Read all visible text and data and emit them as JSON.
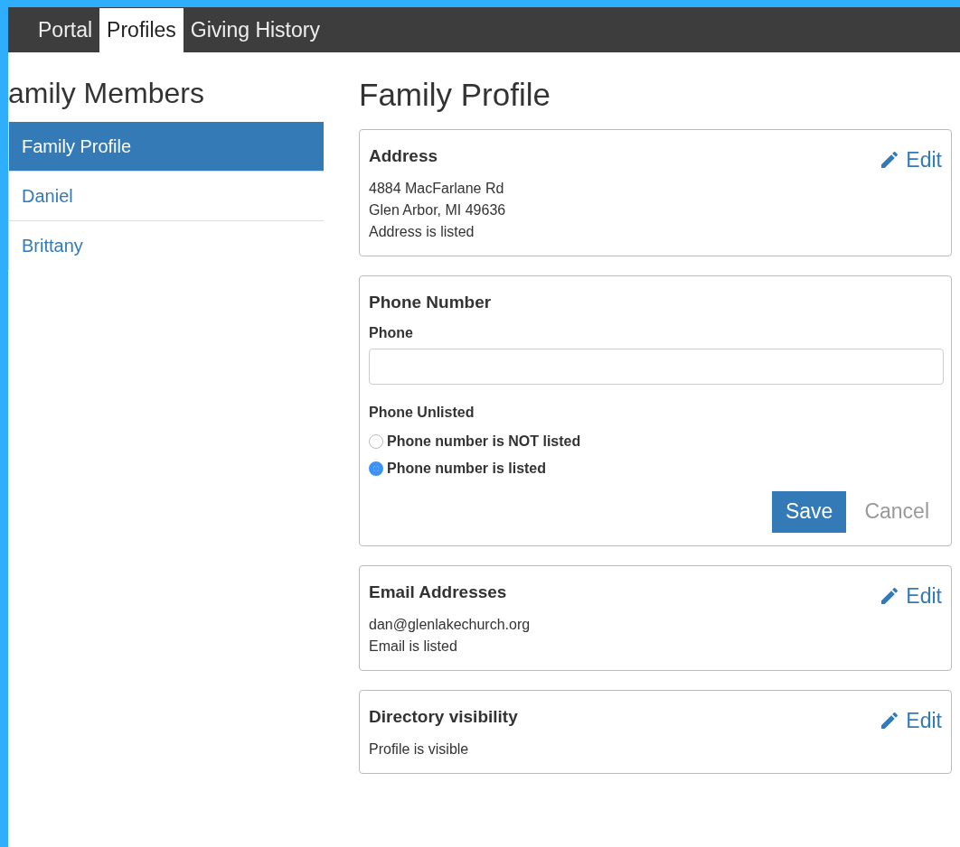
{
  "nav": {
    "tabs": [
      {
        "label": "Portal",
        "selected": false
      },
      {
        "label": "Profiles",
        "selected": true
      },
      {
        "label": "Giving History",
        "selected": false
      }
    ]
  },
  "sidebar": {
    "heading": "amily Members",
    "items": [
      {
        "label": "Family Profile",
        "selected": true
      },
      {
        "label": "Daniel",
        "selected": false
      },
      {
        "label": "Brittany",
        "selected": false
      }
    ]
  },
  "main": {
    "title": "Family Profile",
    "sections": [
      {
        "kind": "display",
        "title": "Address",
        "edit": "Edit",
        "lines": [
          "4884 MacFarlane Rd",
          "Glen Arbor, MI 49636",
          "Address is listed"
        ]
      },
      {
        "kind": "form",
        "title": "Phone Number",
        "field_label": "Phone",
        "radio_label": "Phone Unlisted",
        "options": [
          {
            "label": "Phone number is NOT listed",
            "selected": false
          },
          {
            "label": "Phone number is listed",
            "selected": true
          }
        ],
        "save": "Save",
        "cancel": "Cancel"
      },
      {
        "kind": "display",
        "title": "Email Addresses",
        "edit": "Edit",
        "lines": [
          "dan@glenlakechurch.org",
          "Email is listed"
        ]
      },
      {
        "kind": "display",
        "title": "Directory visibility",
        "edit": "Edit",
        "lines": [
          "Profile is visible"
        ]
      }
    ]
  }
}
